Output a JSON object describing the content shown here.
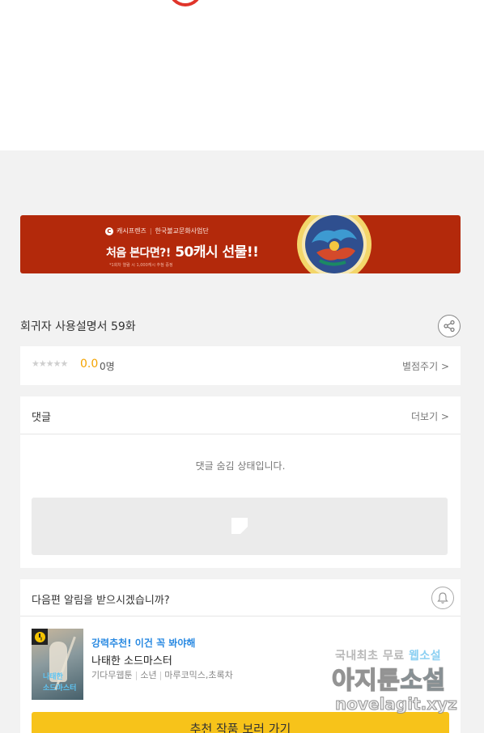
{
  "banner": {
    "brand": "캐시프렌즈",
    "partner": "한국불교문화사업단",
    "headline_pre": "처음 본다면?!",
    "headline_main": "50캐시 선물!!",
    "fineprint": "*1회차 열람 시 1,000캐시 추첨 증정"
  },
  "episode": {
    "title": "회귀자 사용설명서 59화"
  },
  "rating": {
    "stars": "★★★★★",
    "score": "0.0",
    "count": "0명",
    "rate_label": "별점주기 >"
  },
  "comments": {
    "label": "댓글",
    "more_label": "더보기 >",
    "hidden_message": "댓글 숨김 상태입니다."
  },
  "notify": {
    "question": "다음편 알림을 받으시겠습니까?"
  },
  "recommendation": {
    "thumb_title_1": "나태한",
    "thumb_title_2": "소드마스터",
    "tag": "강력추천! 이건 꼭 봐야해",
    "title": "나태한 소드마스터",
    "meta": [
      "기다무웹툰",
      "소년",
      "마루코믹스,초록차"
    ],
    "button_label": "추천 작품 보러 가기"
  },
  "watermark": {
    "line1_pre": "국내최초 무료 ",
    "line1_hl": "웹소설",
    "line2_pre": "아지툰",
    "line2_hl": "소설",
    "line3": "novelagit.xyz"
  },
  "colors": {
    "banner_bg": "#b3290b",
    "score": "#f4a300",
    "tag": "#2a8ae2",
    "button": "#f7c31a"
  }
}
